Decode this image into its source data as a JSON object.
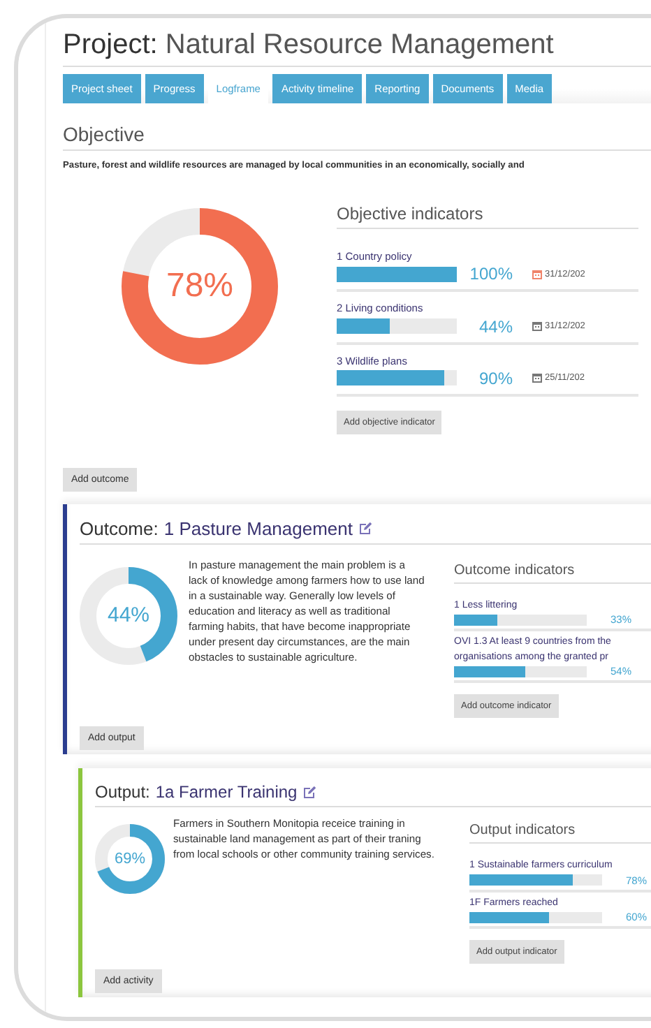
{
  "project": {
    "label": "Project:",
    "name": "Natural Resource Management"
  },
  "tabs": [
    {
      "label": "Project sheet",
      "selected": false
    },
    {
      "label": "Progress",
      "selected": false
    },
    {
      "label": "Logframe",
      "selected": true
    },
    {
      "label": "Activity timeline",
      "selected": false
    },
    {
      "label": "Reporting",
      "selected": false
    },
    {
      "label": "Documents",
      "selected": false
    },
    {
      "label": "Media",
      "selected": false
    }
  ],
  "objective": {
    "heading": "Objective",
    "description": "Pasture, forest and wildlife resources are managed by local communities in an economically, socially and",
    "level": 0.78,
    "percent": "78%",
    "indicators_heading": "Objective indicators",
    "indicators": [
      {
        "title": "1 Country policy",
        "level": 1,
        "percent": "100%",
        "date": "31/12/202",
        "overdue": true
      },
      {
        "title": "2 Living conditions",
        "level": 0.44,
        "percent": "44%",
        "date": "31/12/202",
        "overdue": false
      },
      {
        "title": "3 Wildlife plans",
        "level": 0.9,
        "percent": "90%",
        "date": "25/11/202",
        "overdue": false
      }
    ],
    "add_indicator": "Add objective indicator"
  },
  "add_outcome": "Add outcome",
  "outcome": {
    "label": "Outcome:",
    "title": "1 Pasture Management",
    "description": "In pasture management the main problem is a lack of knowledge among farmers how to use land in a sustainable way. Generally low levels of education and literacy as well as traditional farming habits, that have become inappropriate under present day circumstances, are the main obstacles to sustainable agriculture.",
    "level": 0.44,
    "percent": "44%",
    "indicators_heading": "Outcome indicators",
    "indicators": [
      {
        "title": "1 Less littering",
        "level": 0.33,
        "percent": "33%"
      },
      {
        "title": "OVI 1.3 At least 9 countries from the organisations among the granted pr",
        "level": 0.54,
        "percent": "54%"
      }
    ],
    "add_indicator": "Add outcome indicator",
    "add_child": "Add output"
  },
  "output": {
    "label": "Output:",
    "title": "1a Farmer Training",
    "description": "Farmers in Southern Monitopia receice training in sustainable land management as part of their traning from local schools or other community training services.",
    "level": 0.69,
    "percent": "69%",
    "indicators_heading": "Output indicators",
    "indicators": [
      {
        "title": "1 Sustainable farmers curriculum",
        "level": 0.78,
        "percent": "78%"
      },
      {
        "title": "1F Farmers reached",
        "level": 0.6,
        "percent": "60%"
      }
    ],
    "add_indicator": "Add output indicator",
    "add_child": "Add activity"
  }
}
